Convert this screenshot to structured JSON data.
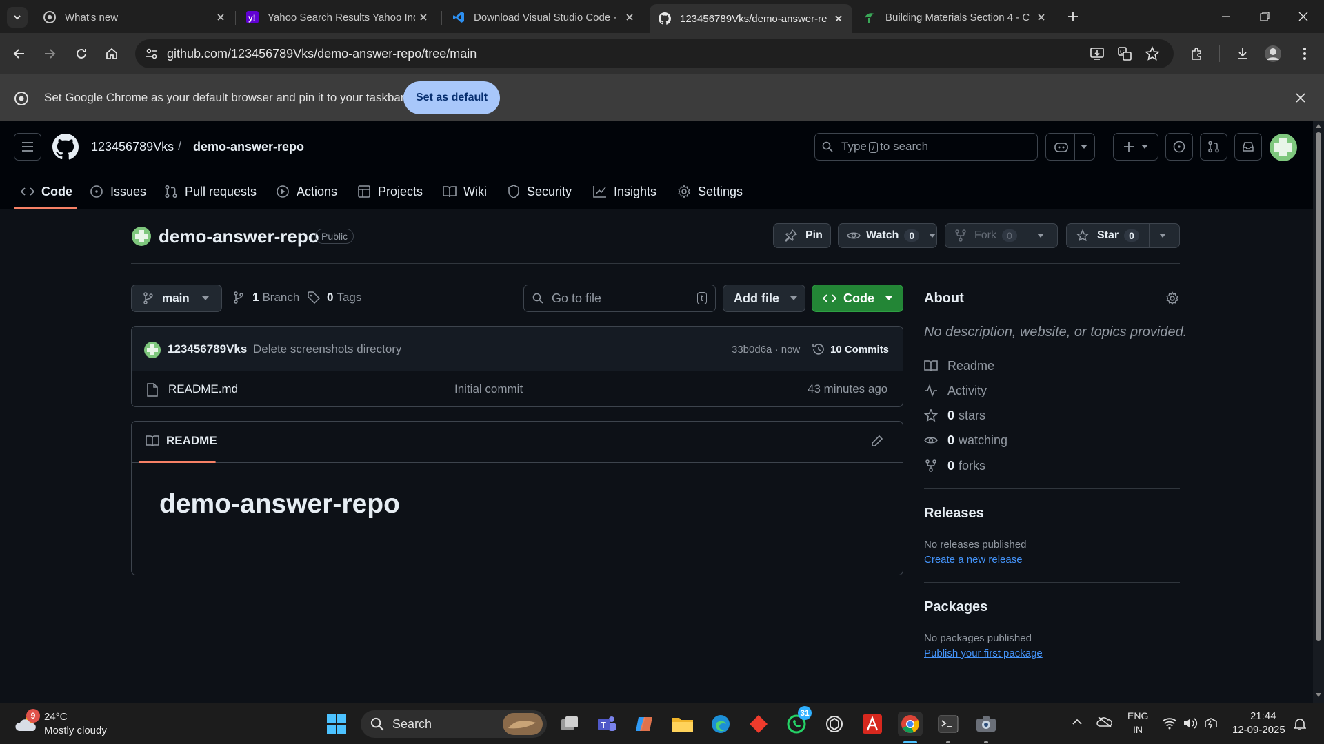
{
  "browser": {
    "tabs": [
      {
        "title": "What's new",
        "icon": "chrome-icon"
      },
      {
        "title": "Yahoo Search Results Yahoo Ind",
        "icon": "yahoo-icon"
      },
      {
        "title": "Download Visual Studio Code -",
        "icon": "vscode-icon"
      },
      {
        "title": "123456789Vks/demo-answer-re",
        "icon": "github-icon"
      },
      {
        "title": "Building Materials Section 4 - C",
        "icon": "building-icon"
      }
    ],
    "url": "github.com/123456789Vks/demo-answer-repo/tree/main",
    "infobar_text": "Set Google Chrome as your default browser and pin it to your taskbar",
    "infobar_button": "Set as default"
  },
  "header": {
    "owner": "123456789Vks",
    "separator": "/",
    "repo": "demo-answer-repo",
    "search_prefix": "Type",
    "search_key": "/",
    "search_suffix": "to search"
  },
  "nav": {
    "tabs": [
      "Code",
      "Issues",
      "Pull requests",
      "Actions",
      "Projects",
      "Wiki",
      "Security",
      "Insights",
      "Settings"
    ]
  },
  "repo": {
    "name": "demo-answer-repo",
    "visibility": "Public",
    "pin_label": "Pin",
    "watch_label": "Watch",
    "watch_count": "0",
    "fork_label": "Fork",
    "fork_count": "0",
    "star_label": "Star",
    "star_count": "0"
  },
  "files": {
    "branch": "main",
    "branch_count": "1",
    "branch_label": "Branch",
    "tag_count": "0",
    "tag_label": "Tags",
    "goto_placeholder": "Go to file",
    "goto_key": "t",
    "add_file": "Add file",
    "code_button": "Code",
    "commit": {
      "author": "123456789Vks",
      "message": "Delete screenshots directory",
      "sha_time": "33b0d6a · now",
      "commits_label": "10 Commits"
    },
    "rows": [
      {
        "name": "README.md",
        "message": "Initial commit",
        "time": "43 minutes ago"
      }
    ]
  },
  "readme": {
    "tab_label": "README",
    "heading": "demo-answer-repo"
  },
  "about": {
    "title": "About",
    "description": "No description, website, or topics provided.",
    "readme": "Readme",
    "activity": "Activity",
    "stars_count": "0",
    "stars_label": "stars",
    "watching_count": "0",
    "watching_label": "watching",
    "forks_count": "0",
    "forks_label": "forks"
  },
  "releases": {
    "title": "Releases",
    "empty": "No releases published",
    "link": "Create a new release"
  },
  "packages": {
    "title": "Packages",
    "empty": "No packages published",
    "link": "Publish your first package"
  },
  "taskbar": {
    "weather_temp": "24°C",
    "weather_desc": "Mostly cloudy",
    "weather_badge": "9",
    "search_label": "Search",
    "whatsapp_badge": "31",
    "lang_top": "ENG",
    "lang_bottom": "IN",
    "time": "21:44",
    "date": "12-09-2025"
  },
  "colors": {
    "accent_green": "#238636",
    "link_blue": "#4493f8",
    "tab_underline": "#f78166",
    "chrome_button": "#a8c7fa"
  }
}
